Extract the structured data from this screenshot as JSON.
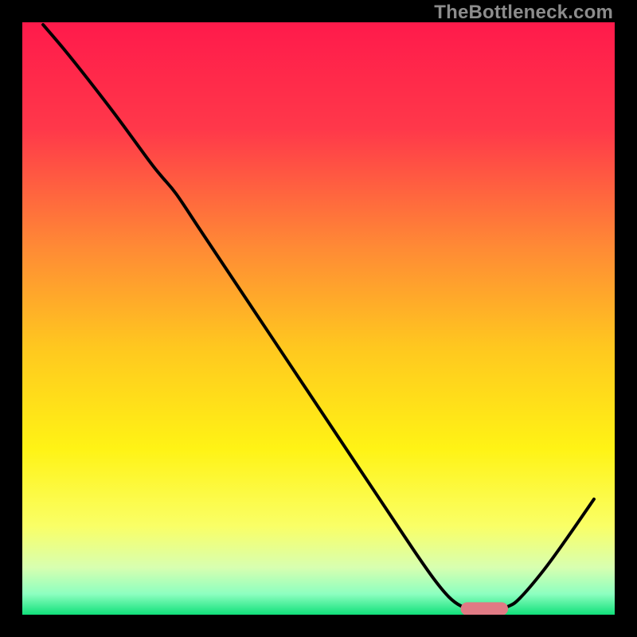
{
  "watermark": "TheBottleneck.com",
  "chart_data": {
    "type": "line",
    "title": "",
    "xlabel": "",
    "ylabel": "",
    "xlim": [
      0,
      100
    ],
    "ylim": [
      0,
      100
    ],
    "grid": false,
    "legend": false,
    "background_gradient_stops": [
      {
        "pct": 0,
        "color": "#ff1a4b"
      },
      {
        "pct": 18,
        "color": "#ff384a"
      },
      {
        "pct": 38,
        "color": "#ff8a35"
      },
      {
        "pct": 55,
        "color": "#ffc81f"
      },
      {
        "pct": 72,
        "color": "#fff315"
      },
      {
        "pct": 85,
        "color": "#faff66"
      },
      {
        "pct": 92,
        "color": "#d8ffb0"
      },
      {
        "pct": 96.5,
        "color": "#8dffc0"
      },
      {
        "pct": 100,
        "color": "#11e07a"
      }
    ],
    "curve": [
      {
        "x": 3.5,
        "y": 99.6
      },
      {
        "x": 7.0,
        "y": 95.5
      },
      {
        "x": 11.0,
        "y": 90.5
      },
      {
        "x": 16.0,
        "y": 84.0
      },
      {
        "x": 21.5,
        "y": 76.5
      },
      {
        "x": 23.5,
        "y": 74.0
      },
      {
        "x": 26.0,
        "y": 71.0
      },
      {
        "x": 30.0,
        "y": 65.0
      },
      {
        "x": 36.0,
        "y": 56.0
      },
      {
        "x": 42.0,
        "y": 47.0
      },
      {
        "x": 48.0,
        "y": 38.0
      },
      {
        "x": 54.0,
        "y": 29.0
      },
      {
        "x": 60.0,
        "y": 20.0
      },
      {
        "x": 66.0,
        "y": 11.0
      },
      {
        "x": 69.5,
        "y": 6.0
      },
      {
        "x": 72.0,
        "y": 3.0
      },
      {
        "x": 74.0,
        "y": 1.5
      },
      {
        "x": 76.0,
        "y": 1.0
      },
      {
        "x": 80.0,
        "y": 1.0
      },
      {
        "x": 82.0,
        "y": 1.4
      },
      {
        "x": 84.0,
        "y": 2.8
      },
      {
        "x": 88.0,
        "y": 7.5
      },
      {
        "x": 92.0,
        "y": 13.0
      },
      {
        "x": 96.5,
        "y": 19.5
      }
    ],
    "marker": {
      "x_center": 78.0,
      "y_center": 1.0,
      "width": 8.0,
      "height": 2.2,
      "color": "#e07a84"
    }
  }
}
